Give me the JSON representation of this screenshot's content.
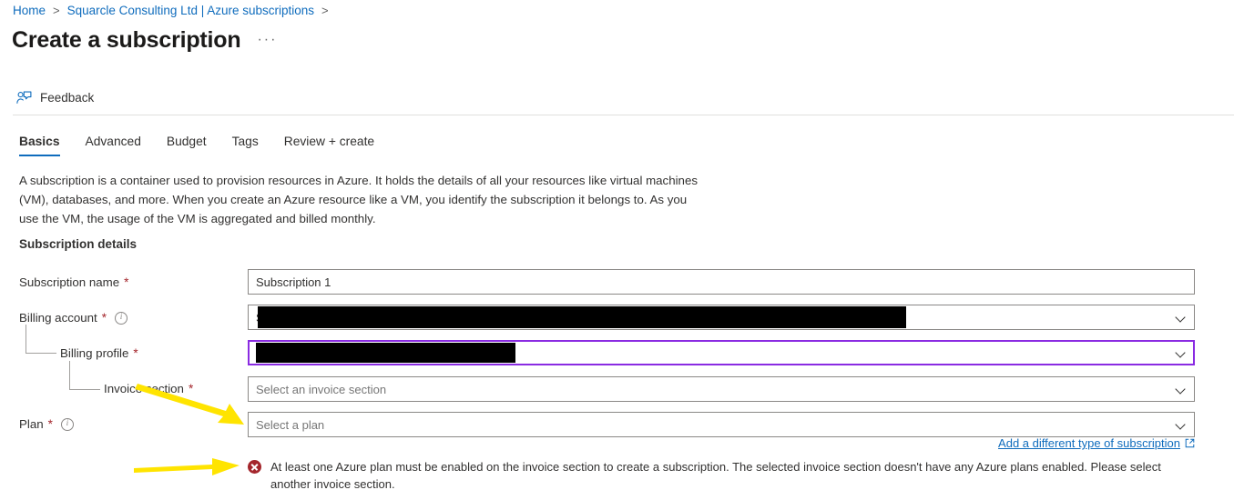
{
  "breadcrumb": {
    "items": [
      {
        "label": "Home"
      },
      {
        "label": "Squarcle Consulting Ltd | Azure subscriptions"
      }
    ],
    "separator": ">"
  },
  "header": {
    "title": "Create a subscription",
    "more_menu": "···"
  },
  "commandbar": {
    "feedback_label": "Feedback",
    "feedback_icon": "person-feedback-icon"
  },
  "tabs": [
    {
      "label": "Basics",
      "active": true
    },
    {
      "label": "Advanced",
      "active": false
    },
    {
      "label": "Budget",
      "active": false
    },
    {
      "label": "Tags",
      "active": false
    },
    {
      "label": "Review + create",
      "active": false
    }
  ],
  "description": "A subscription is a container used to provision resources in Azure. It holds the details of all your resources like virtual machines (VM), databases, and more. When you create an Azure resource like a VM, you identify the subscription it belongs to. As you use the VM, the usage of the VM is aggregated and billed monthly.",
  "section": {
    "title": "Subscription details"
  },
  "fields": {
    "subscription_name": {
      "label": "Subscription name",
      "required_marker": "*",
      "value": "Subscription 1",
      "placeholder": "Subscription 1"
    },
    "billing_account": {
      "label": "Billing account",
      "required_marker": "*",
      "value": "S",
      "redacted": true,
      "has_info": true,
      "chevron_icon": "chevron-down-icon"
    },
    "billing_profile": {
      "label": "Billing profile",
      "required_marker": "*",
      "value": "",
      "redacted": true,
      "focused": true,
      "chevron_icon": "chevron-down-icon"
    },
    "invoice_section": {
      "label": "Invoice section",
      "required_marker": "*",
      "placeholder": "Select an invoice section",
      "chevron_icon": "chevron-down-icon"
    },
    "plan": {
      "label": "Plan",
      "required_marker": "*",
      "placeholder": "Select a plan",
      "has_info": true,
      "chevron_icon": "chevron-down-icon"
    }
  },
  "links": {
    "add_subscription_type": "Add a different type of subscription",
    "external_icon": "external-link-icon"
  },
  "error": {
    "icon": "error-circle-x-icon",
    "message": "At least one Azure plan must be enabled on the invoice section to create a subscription. The selected invoice section doesn't have any Azure plans enabled. Please select another invoice section."
  },
  "annotations": {
    "arrow_color": "#FFE400",
    "arrow_plan": "arrow-pointing-to-plan-dropdown",
    "arrow_error": "arrow-pointing-to-error-message"
  },
  "colors": {
    "link": "#0f6cbd",
    "required": "#a4262c",
    "error": "#a4262c",
    "focus_border": "#8a2be2",
    "tab_active_underline": "#0f6cbd"
  }
}
